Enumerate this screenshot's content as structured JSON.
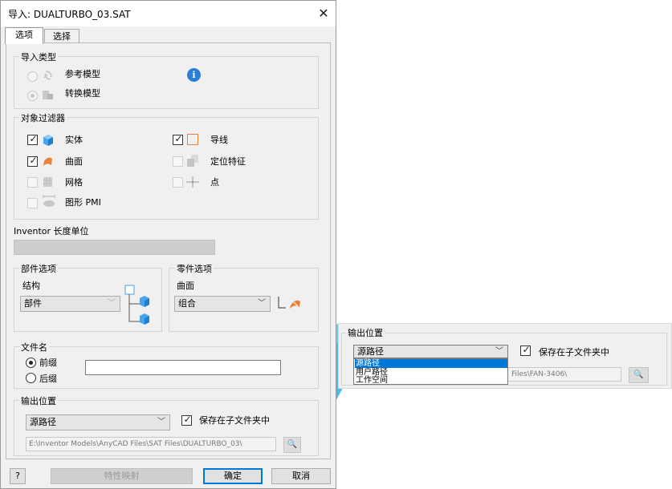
{
  "dialog": {
    "title": "导入: DUALTURBO_03.SAT",
    "close_glyph": "✕",
    "tabs": [
      "选项",
      "选择"
    ],
    "import_type": {
      "title": "导入类型",
      "options": [
        "参考模型",
        "转换模型"
      ],
      "info_glyph": "i"
    },
    "object_filter": {
      "title": "对象过滤器",
      "items": [
        "实体",
        "曲面",
        "网格",
        "图形 PMI",
        "导线",
        "定位特征",
        "点"
      ],
      "checked": [
        true,
        true,
        false,
        false,
        true,
        false,
        false
      ]
    },
    "units_label": "Inventor 长度单位",
    "assembly": {
      "title": "部件选项",
      "structure_label": "结构",
      "structure_value": "部件"
    },
    "part": {
      "title": "零件选项",
      "surface_label": "曲面",
      "surface_value": "组合"
    },
    "filename": {
      "title": "文件名",
      "prefix": "前缀",
      "suffix": "后缀",
      "value": ""
    },
    "output": {
      "title": "输出位置",
      "location": "源路径",
      "save_sub": "保存在子文件夹中",
      "path": "E:\\Inventor Models\\AnyCAD Files\\SAT Files\\DUALTURBO_03\\"
    },
    "footer": {
      "help": "?",
      "mapping": "特性映射",
      "ok": "确定",
      "cancel": "取消"
    }
  },
  "zoom": {
    "title": "输出位置",
    "location": "源路径",
    "save_sub": "保存在子文件夹中",
    "options": [
      "源路径",
      "用户路径",
      "工作空间"
    ],
    "path": "Files\\FAN-3406\\",
    "highlight_color": "#0078d7",
    "callout_color": "#5bc8f0"
  }
}
